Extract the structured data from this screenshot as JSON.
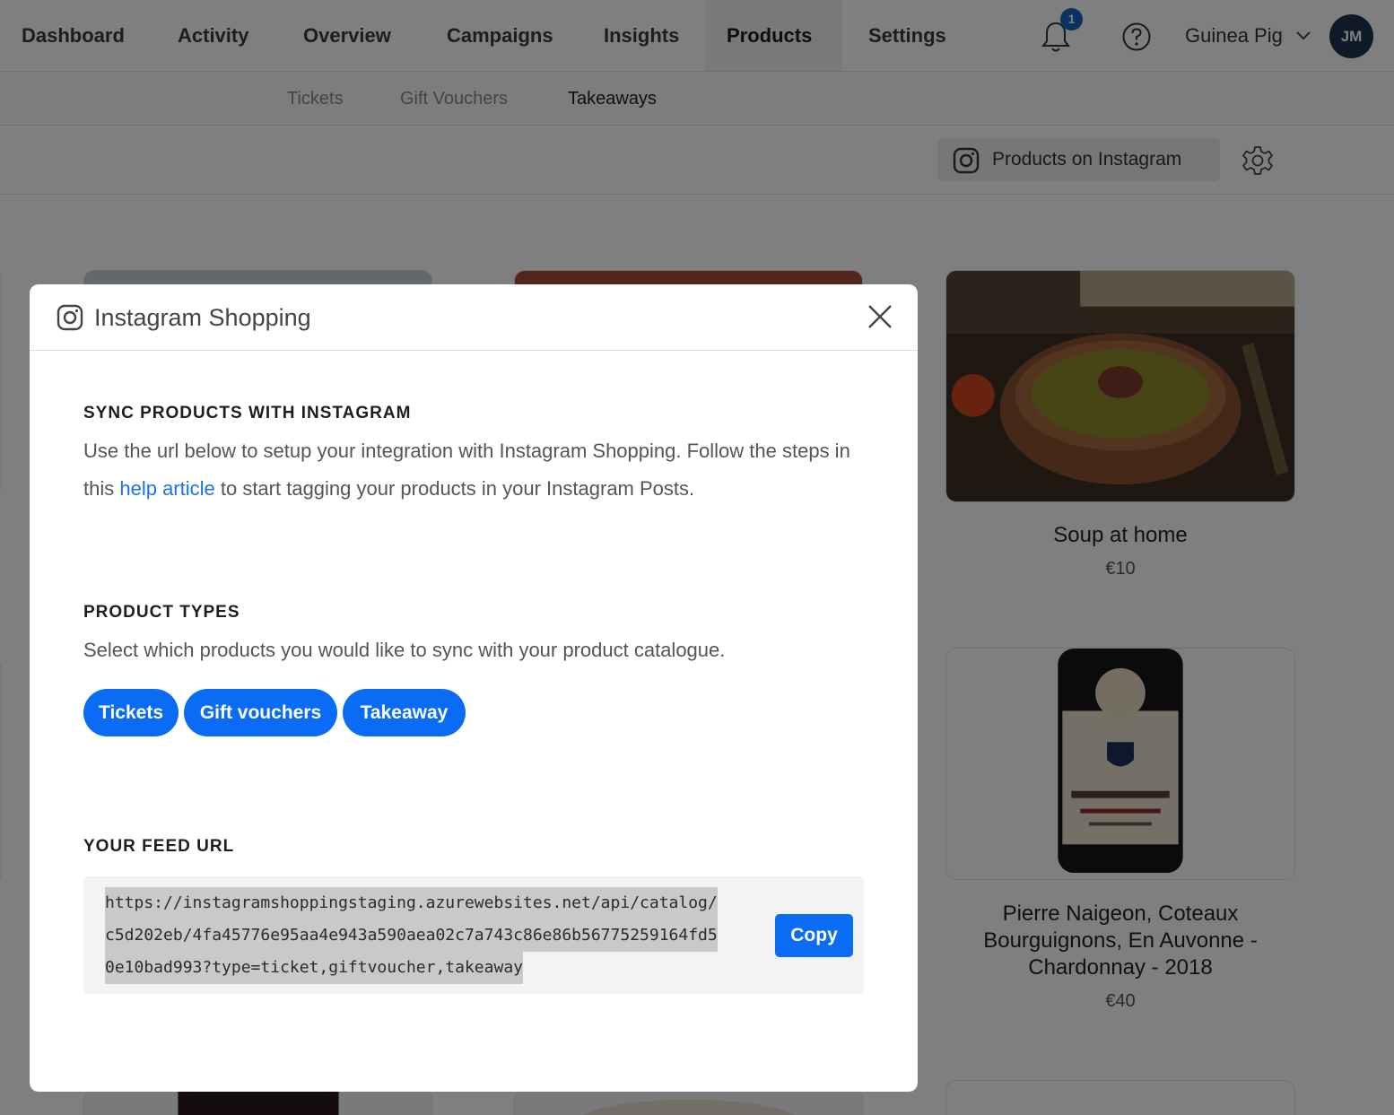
{
  "nav": {
    "items": [
      "Dashboard",
      "Activity",
      "Overview",
      "Campaigns",
      "Insights",
      "Products",
      "Settings"
    ],
    "active": "Products",
    "notifications_count": "1",
    "user_name": "Guinea Pig",
    "avatar_initials": "JM"
  },
  "subnav": {
    "items": [
      "Tickets",
      "Gift Vouchers",
      "Takeaways"
    ],
    "active": "Takeaways"
  },
  "toolbar": {
    "instagram_button_label": "Products on Instagram"
  },
  "products": [
    {
      "title": "Soup at home",
      "price": "€10"
    },
    {
      "title": "Pierre Naigeon, Coteaux Bourguignons, En Auvonne - Chardonnay - 2018",
      "price": "€40"
    }
  ],
  "modal": {
    "title": "Instagram Shopping",
    "sync": {
      "heading": "SYNC PRODUCTS WITH INSTAGRAM",
      "text_before": "Use the url below to setup your integration with Instagram Shopping. Follow the steps in this ",
      "link_text": "help article",
      "text_after": " to start tagging your products in your Instagram Posts."
    },
    "product_types": {
      "heading": "PRODUCT TYPES",
      "text": "Select which products you would like to sync with your product catalogue.",
      "options": [
        "Tickets",
        "Gift vouchers",
        "Takeaway"
      ]
    },
    "feed": {
      "heading": "YOUR FEED URL",
      "url_lines": [
        "https://instagramshoppingstaging.azurewebsites.net/api/catalog/",
        "c5d202eb/4fa45776e95aa4e943a590aea02c7a743c86e86b56775259164fd5",
        "0e10bad993?type=ticket,giftvoucher,takeaway"
      ],
      "copy_label": "Copy"
    }
  },
  "colors": {
    "accent": "#0a6cf5",
    "link": "#1a73e8",
    "badge": "#1565c0",
    "avatar": "#1f3550"
  },
  "icons": [
    "bell-icon",
    "help-icon",
    "chevron-down-icon",
    "instagram-icon",
    "gear-icon",
    "close-icon"
  ]
}
